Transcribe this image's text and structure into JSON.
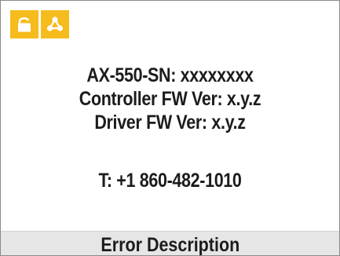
{
  "toolbar": {
    "buttons": [
      {
        "icon": "lock-icon",
        "color": "#f6bb1d"
      },
      {
        "icon": "network-icon",
        "color": "#f6bb1d"
      }
    ]
  },
  "device_info": {
    "serial_line": "AX-550-SN: xxxxxxxx",
    "controller_fw_line": "Controller FW Ver: x.y.z",
    "driver_fw_line": "Driver FW Ver: x.y.z",
    "phone_line": "T: +1 860-482-1010"
  },
  "footer": {
    "label": "Error Description"
  }
}
